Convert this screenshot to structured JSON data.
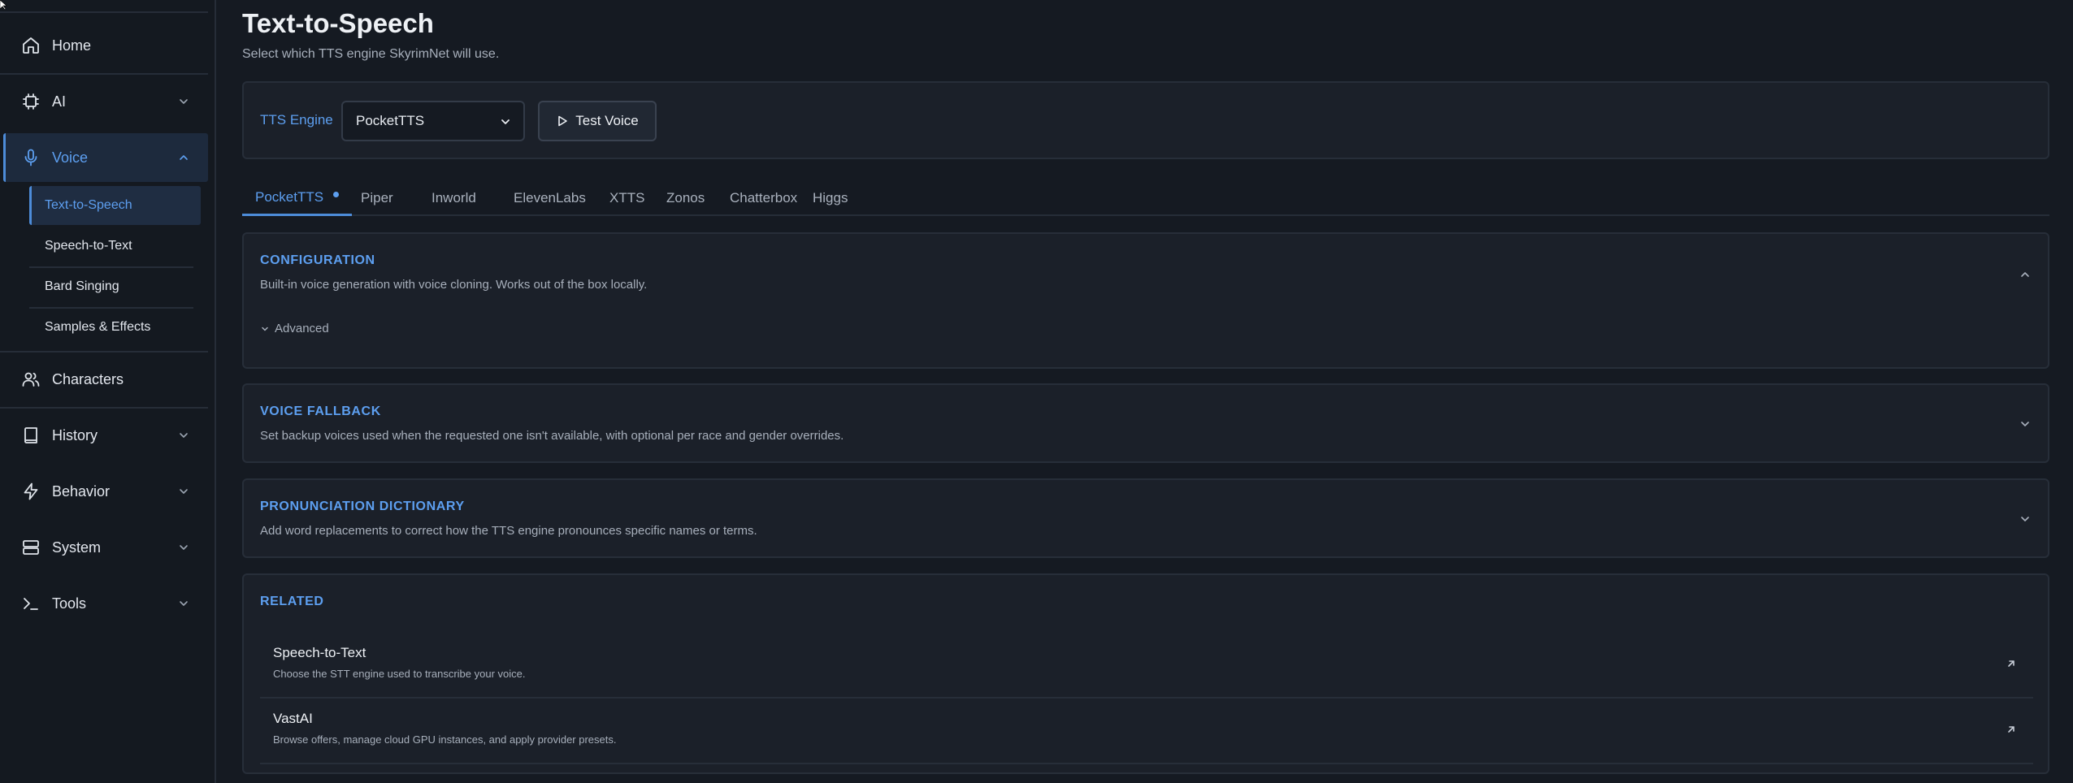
{
  "sidebar": {
    "items": [
      {
        "label": "Home",
        "icon": "home-icon"
      },
      {
        "label": "AI",
        "icon": "chip-icon"
      },
      {
        "label": "Voice",
        "icon": "microphone-icon"
      },
      {
        "label": "Characters",
        "icon": "users-icon"
      },
      {
        "label": "History",
        "icon": "book-icon"
      },
      {
        "label": "Behavior",
        "icon": "lightning-icon"
      },
      {
        "label": "System",
        "icon": "server-icon"
      },
      {
        "label": "Tools",
        "icon": "terminal-icon"
      }
    ],
    "voice_subitems": [
      {
        "label": "Text-to-Speech"
      },
      {
        "label": "Speech-to-Text"
      },
      {
        "label": "Bard Singing"
      },
      {
        "label": "Samples & Effects"
      }
    ]
  },
  "header": {
    "title": "Text-to-Speech",
    "subtitle": "Select which TTS engine SkyrimNet will use."
  },
  "engine": {
    "label": "TTS Engine",
    "selected": "PocketTTS",
    "test_button": "Test Voice"
  },
  "tabs": [
    {
      "label": "PocketTTS"
    },
    {
      "label": "Piper"
    },
    {
      "label": "Inworld"
    },
    {
      "label": "ElevenLabs"
    },
    {
      "label": "XTTS"
    },
    {
      "label": "Zonos"
    },
    {
      "label": "Chatterbox"
    },
    {
      "label": "Higgs"
    }
  ],
  "sections": {
    "configuration": {
      "title": "CONFIGURATION",
      "description": "Built-in voice generation with voice cloning. Works out of the box locally.",
      "advanced_label": "Advanced"
    },
    "voice_fallback": {
      "title": "VOICE FALLBACK",
      "description": "Set backup voices used when the requested one isn't available, with optional per race and gender overrides."
    },
    "pronunciation": {
      "title": "PRONUNCIATION DICTIONARY",
      "description": "Add word replacements to correct how the TTS engine pronounces specific names or terms."
    },
    "related": {
      "title": "RELATED",
      "items": [
        {
          "title": "Speech-to-Text",
          "description": "Choose the STT engine used to transcribe your voice."
        },
        {
          "title": "VastAI",
          "description": "Browse offers, manage cloud GPU instances, and apply provider presets."
        }
      ]
    }
  },
  "colors": {
    "accent": "#5d9ff0",
    "background": "#151a22",
    "card": "#1b2029"
  }
}
